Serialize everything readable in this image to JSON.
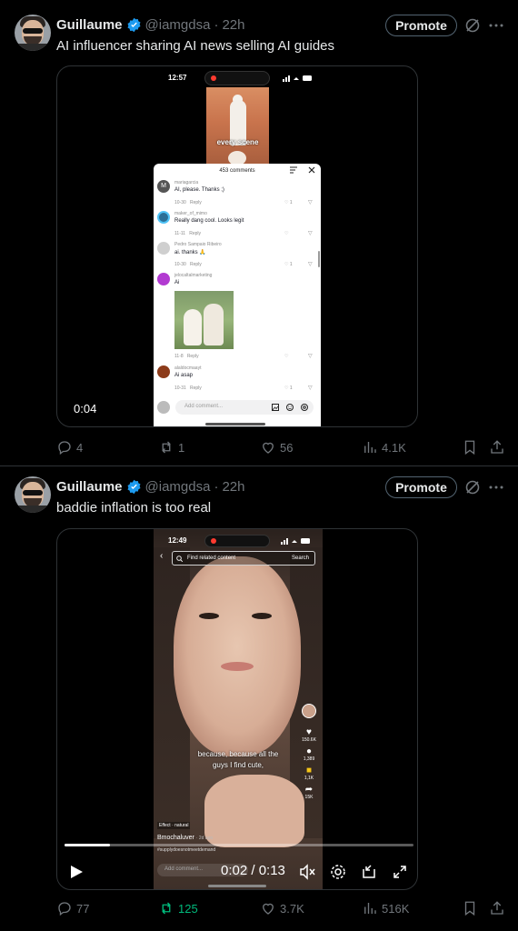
{
  "tweets": [
    {
      "author": {
        "name": "Guillaume",
        "handle": "@iamgdsa",
        "time": "22h"
      },
      "promote_label": "Promote",
      "text": "AI influencer sharing AI news selling AI guides",
      "video": {
        "duration_label": "0:04",
        "phone_time": "12:57",
        "thumbnail_caption": "every scene",
        "comments_title": "453 comments",
        "comments": [
          {
            "user": "mariagarcia",
            "text": "AI, please. Thanks ;)",
            "time": "10-30",
            "reply": "Reply",
            "likes": "1",
            "avatar_letter": "M",
            "avatar_color": "#555555"
          },
          {
            "user": "maker_of_mimo",
            "text": "Really dang cool. Looks legit",
            "time": "11-11",
            "reply": "Reply",
            "likes": "",
            "avatar_letter": "",
            "avatar_color": "#2a6f97"
          },
          {
            "user": "Pedro Sampaio Ribeiro",
            "text": "ai. thanks 🙏",
            "time": "10-30",
            "reply": "Reply",
            "likes": "1",
            "avatar_letter": "",
            "avatar_color": "#cccccc"
          },
          {
            "user": "jelocaltalmarketing",
            "text": "Ai",
            "time": "11-8",
            "reply": "Reply",
            "likes": "",
            "avatar_letter": "",
            "avatar_color": "#b23ad1"
          },
          {
            "user": "alaldocmaayt",
            "text": "Ai asap",
            "time": "10-31",
            "reply": "Reply",
            "likes": "1",
            "avatar_letter": "",
            "avatar_color": "#8c3b1a"
          }
        ],
        "add_comment_placeholder": "Add comment..."
      },
      "stats": {
        "replies": "4",
        "reposts": "1",
        "likes": "56",
        "views": "4.1K"
      }
    },
    {
      "author": {
        "name": "Guillaume",
        "handle": "@iamgdsa",
        "time": "22h"
      },
      "promote_label": "Promote",
      "text": "baddie inflation is too real",
      "video": {
        "phone_time": "12:49",
        "search_placeholder": "Find related content",
        "search_button": "Search",
        "subtitle_line1": "because, because all the",
        "subtitle_line2": "guys I find cute,",
        "like_count": "150.6K",
        "comment_count": "1,389",
        "save_count": "1,1K",
        "share_count": "15K",
        "effect_label": "Effect · natural",
        "username": "Bmochaluver",
        "username_time": "· 2d ago",
        "hashtags": "#supplydoesnotmeetdemand",
        "add_comment_placeholder": "Add comment...",
        "playback_time": "0:02 / 0:13",
        "progress_fraction": 0.13
      },
      "stats": {
        "replies": "77",
        "reposts": "125",
        "likes": "3.7K",
        "views": "516K"
      }
    }
  ],
  "colors": {
    "background": "#000000",
    "text": "#e7e9ea",
    "muted": "#71767b",
    "verified": "#1d9bf0",
    "repost_active": "#00ba7c",
    "border": "#2f3336"
  }
}
